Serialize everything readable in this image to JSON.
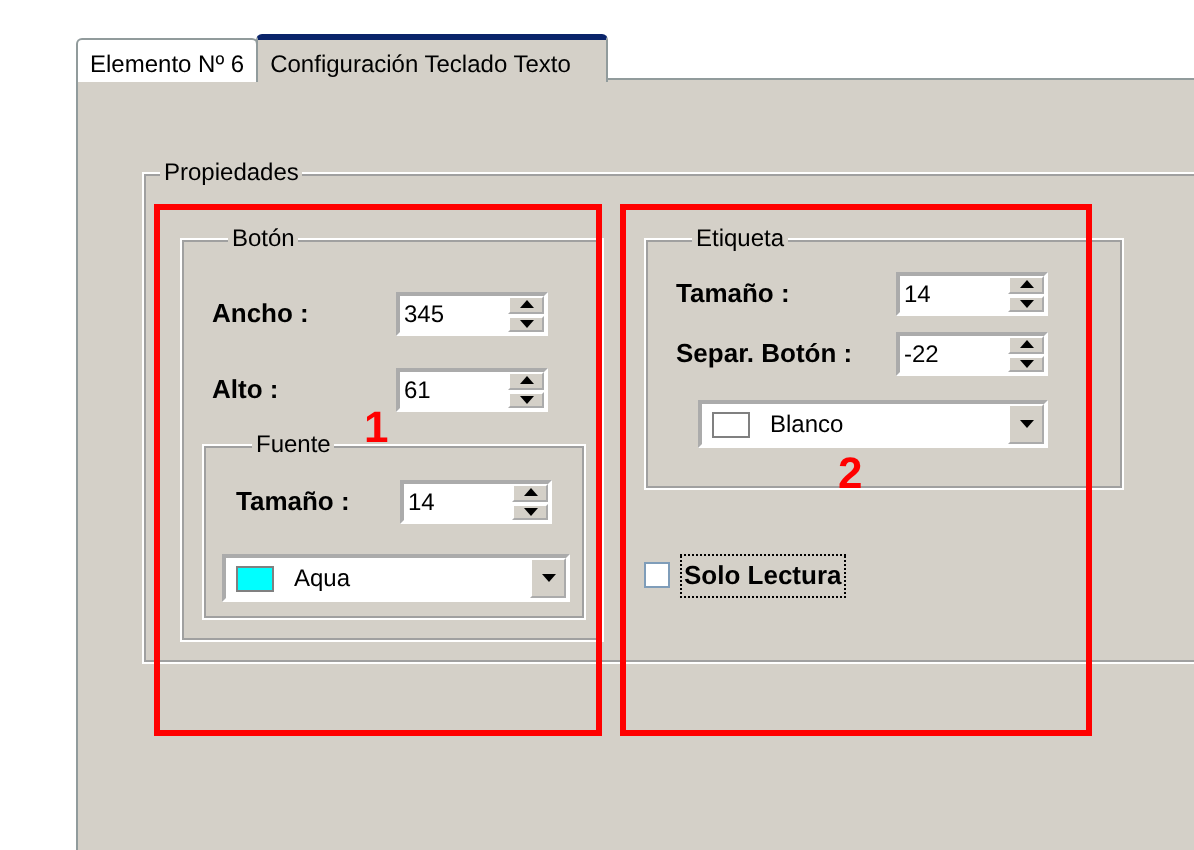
{
  "tabs": [
    {
      "label": "Elemento Nº 6",
      "selected": false
    },
    {
      "label": "Configuración Teclado Texto",
      "selected": true
    }
  ],
  "propiedades": {
    "title": "Propiedades"
  },
  "boton": {
    "title": "Botón",
    "fields": [
      {
        "label": "Ancho :",
        "value": "345"
      },
      {
        "label": "Alto :",
        "value": "61"
      }
    ],
    "fuente": {
      "title": "Fuente",
      "fields": [
        {
          "label": "Tamaño :",
          "value": "14"
        }
      ],
      "color_select": {
        "value": "Aqua",
        "color": "#00ffff"
      }
    }
  },
  "etiqueta": {
    "title": "Etiqueta",
    "fields": [
      {
        "label": "Tamaño :",
        "value": "14"
      },
      {
        "label": "Separ. Botón :",
        "value": "-22"
      }
    ],
    "color_select": {
      "value": "Blanco",
      "color": "#ffffff"
    }
  },
  "solo_lectura": {
    "label": "Solo Lectura",
    "checked": false,
    "focused": true
  },
  "annotations": [
    {
      "label": "1"
    },
    {
      "label": "2"
    }
  ]
}
